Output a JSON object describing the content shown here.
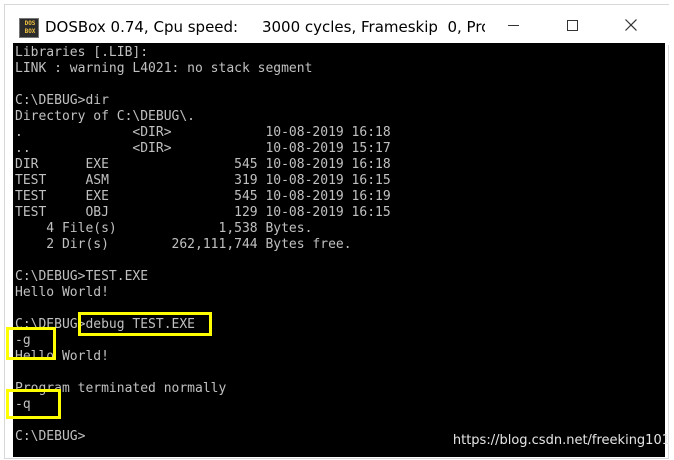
{
  "window": {
    "title": "DOSBox 0.74, Cpu speed:     3000 cycles, Frameskip  0, Pro...",
    "icon_top": "DOS",
    "icon_bottom": "BOX",
    "controls": [
      "minimize-icon",
      "maximize-icon",
      "close-icon"
    ]
  },
  "console": {
    "lines": [
      "Libraries [.LIB]:",
      "LINK : warning L4021: no stack segment",
      "",
      "C:\\DEBUG>dir",
      "Directory of C:\\DEBUG\\.",
      ".              <DIR>            10-08-2019 16:18",
      "..             <DIR>            10-08-2019 15:17",
      "DIR      EXE                545 10-08-2019 16:18",
      "TEST     ASM                319 10-08-2019 16:15",
      "TEST     EXE                545 10-08-2019 16:19",
      "TEST     OBJ                129 10-08-2019 16:15",
      "    4 File(s)             1,538 Bytes.",
      "    2 Dir(s)        262,111,744 Bytes free.",
      "",
      "C:\\DEBUG>TEST.EXE",
      "Hello World!",
      "",
      "C:\\DEBUG>debug TEST.EXE",
      "-g",
      "Hello World!",
      "",
      "Program terminated normally",
      "-q",
      "",
      "C:\\DEBUG>"
    ]
  },
  "highlight_color": "#ffff00",
  "watermark": "https://blog.csdn.net/freeking101"
}
